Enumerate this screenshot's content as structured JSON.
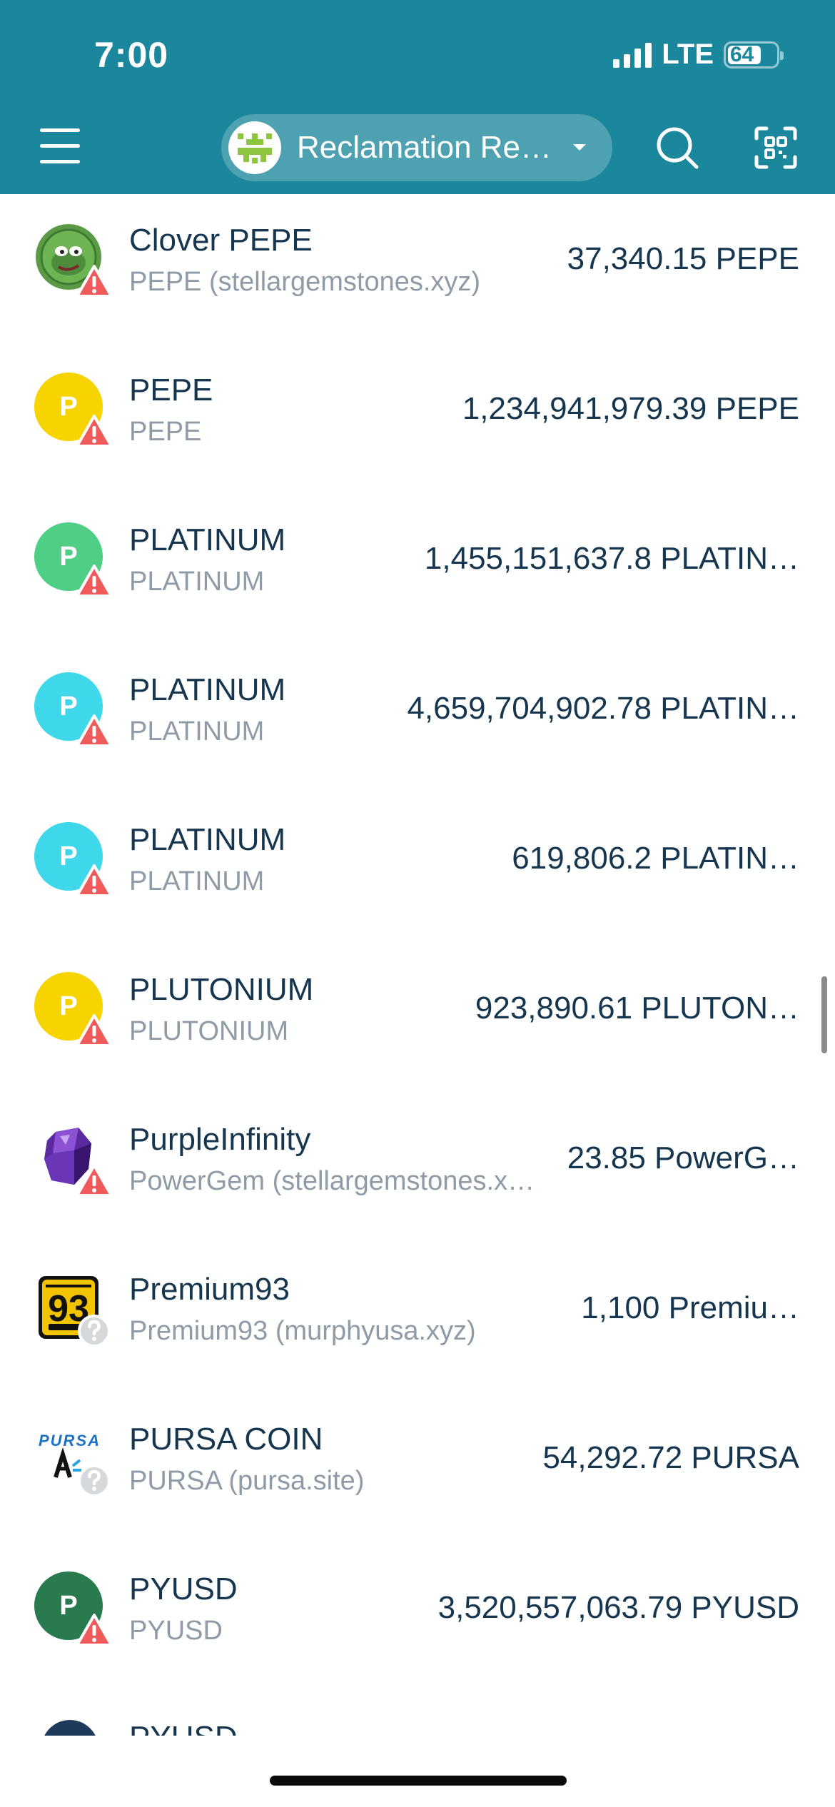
{
  "status_bar": {
    "time": "7:00",
    "network": "LTE",
    "battery": "64"
  },
  "header": {
    "account_name": "Reclamation Re…"
  },
  "assets": [
    {
      "name": "Clover PEPE",
      "sub": "PEPE (stellargemstones.xyz)",
      "amount": "37,340.15 PEPE",
      "icon_letter": "",
      "icon_color": "#3f8f3a",
      "icon": "pepe-frog-icon",
      "badge": "warning"
    },
    {
      "name": "PEPE",
      "sub": "PEPE",
      "amount": "1,234,941,979.39 PEPE",
      "icon_letter": "P",
      "icon_color": "#f7d300",
      "icon": "letter-p-icon",
      "badge": "warning"
    },
    {
      "name": "PLATINUM",
      "sub": "PLATINUM",
      "amount": "1,455,151,637.8 PLATIN…",
      "icon_letter": "P",
      "icon_color": "#4fcf86",
      "icon": "letter-p-icon",
      "badge": "warning"
    },
    {
      "name": "PLATINUM",
      "sub": "PLATINUM",
      "amount": "4,659,704,902.78 PLATIN…",
      "icon_letter": "P",
      "icon_color": "#3fd8ea",
      "icon": "letter-p-icon",
      "badge": "warning"
    },
    {
      "name": "PLATINUM",
      "sub": "PLATINUM",
      "amount": "619,806.2 PLATIN…",
      "icon_letter": "P",
      "icon_color": "#3fd8ea",
      "icon": "letter-p-icon",
      "badge": "warning"
    },
    {
      "name": "PLUTONIUM",
      "sub": "PLUTONIUM",
      "amount": "923,890.61 PLUTON…",
      "icon_letter": "P",
      "icon_color": "#f7d300",
      "icon": "letter-p-icon",
      "badge": "warning"
    },
    {
      "name": "PurpleInfinity",
      "sub": "PowerGem (stellargemstones.x…",
      "amount": "23.85 PowerG…",
      "icon_letter": "",
      "icon_color": "#5a2a9a",
      "icon": "purple-gem-icon",
      "badge": "warning"
    },
    {
      "name": "Premium93",
      "sub": "Premium93 (murphyusa.xyz)",
      "amount": "1,100 Premiu…",
      "icon_letter": "93",
      "icon_color": "#f2c400",
      "icon": "premium93-icon",
      "badge": "unknown"
    },
    {
      "name": "PURSA COIN",
      "sub": "PURSA (pursa.site)",
      "amount": "54,292.72 PURSA",
      "icon_letter": "PURSA",
      "icon_color": "#ffffff",
      "icon": "pursa-logo-icon",
      "badge": "unknown"
    },
    {
      "name": "PYUSD",
      "sub": "PYUSD",
      "amount": "3,520,557,063.79 PYUSD",
      "icon_letter": "P",
      "icon_color": "#2a7a4f",
      "icon": "letter-p-icon",
      "badge": "warning"
    }
  ],
  "partial_row": {
    "name": "PYUSD"
  }
}
